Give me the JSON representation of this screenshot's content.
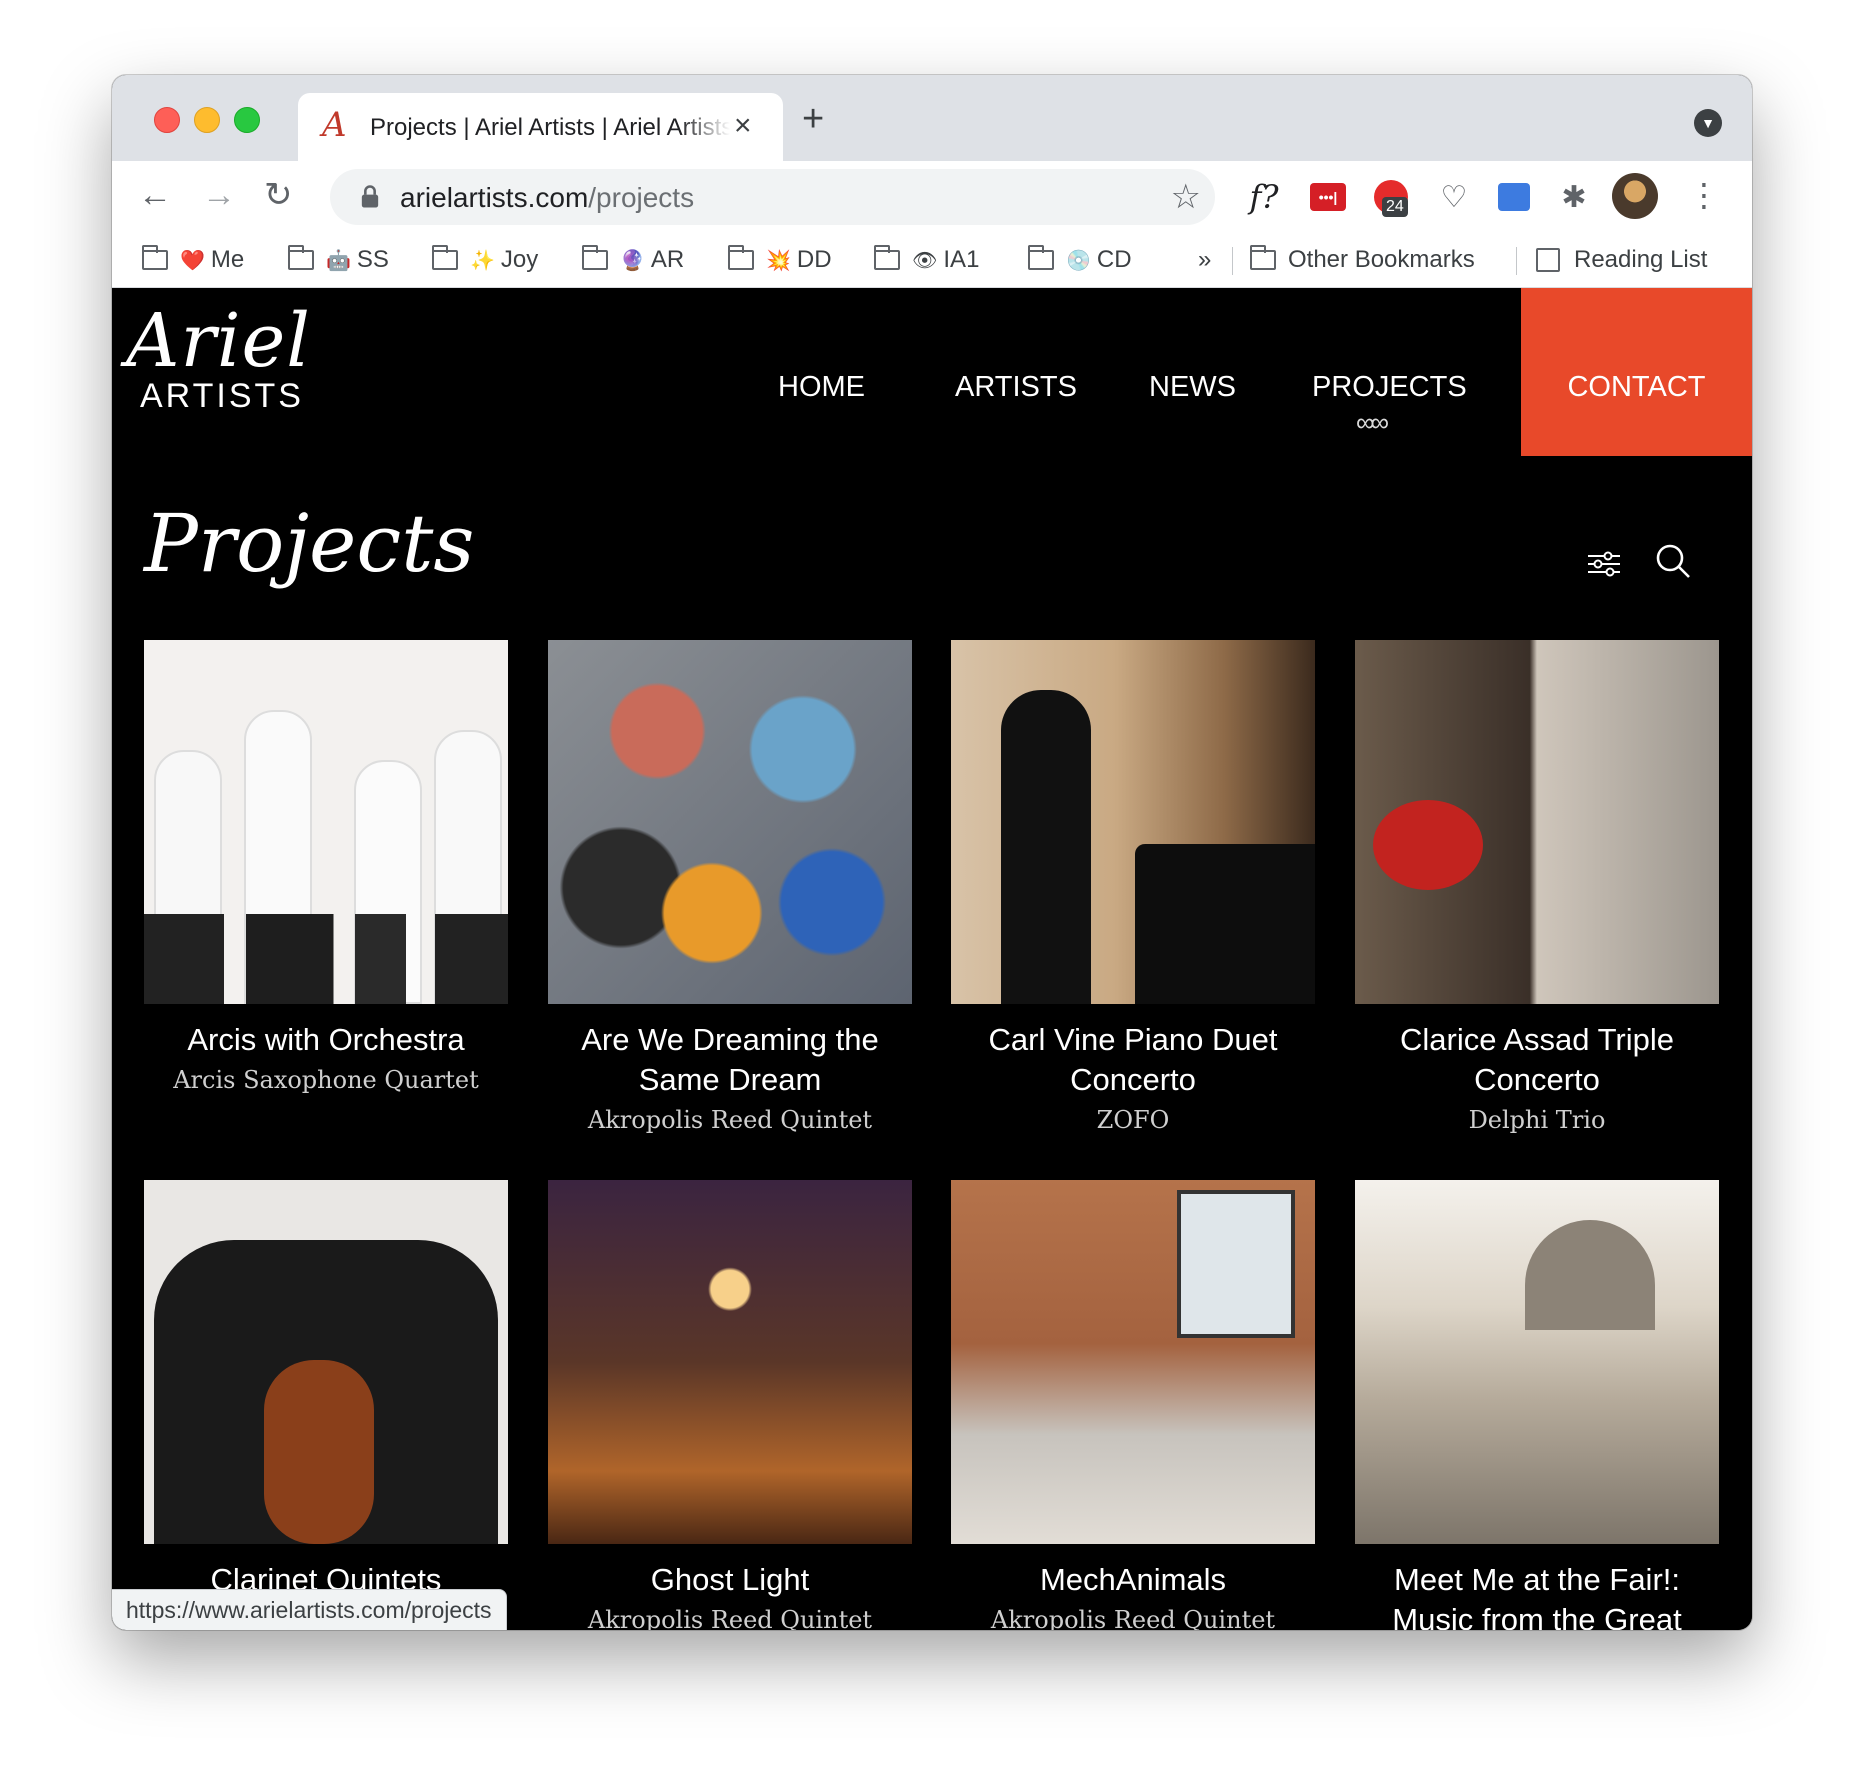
{
  "browser": {
    "tab_title": "Projects | Ariel Artists | Ariel Artists",
    "tab_favicon": "A",
    "url_host": "arielartists.com",
    "url_path": "/projects",
    "status_url": "https://www.arielartists.com/projects",
    "extensions": {
      "fx_label": "f?",
      "adblock_badge": "24"
    },
    "bookmarks": [
      {
        "emoji": "❤️",
        "label": "Me"
      },
      {
        "emoji": "🤖",
        "label": "SS"
      },
      {
        "emoji": "✨",
        "label": "Joy"
      },
      {
        "emoji": "🔮",
        "label": "AR"
      },
      {
        "emoji": "💥",
        "label": "DD"
      },
      {
        "emoji": "👁",
        "label": "IA1"
      },
      {
        "emoji": "💿",
        "label": "CD"
      }
    ],
    "bookmarks_overflow": "»",
    "other_bookmarks": "Other Bookmarks",
    "reading_list": "Reading List"
  },
  "site": {
    "logo_script": "Ariel",
    "logo_sub": "ARTISTS",
    "nav": {
      "home": "HOME",
      "artists": "ARTISTS",
      "news": "NEWS",
      "projects": "PROJECTS",
      "contact": "CONTACT"
    },
    "active_nav": "PROJECTS",
    "accent_color": "#e8492a",
    "page_title": "Projects"
  },
  "projects": [
    {
      "title_lines": [
        "Arcis with Orchestra"
      ],
      "artist": "Arcis Saxophone Quartet"
    },
    {
      "title_lines": [
        "Are We Dreaming the",
        "Same Dream"
      ],
      "artist": "Akropolis Reed Quintet"
    },
    {
      "title_lines": [
        "Carl Vine Piano Duet",
        "Concerto"
      ],
      "artist": "ZOFO"
    },
    {
      "title_lines": [
        "Clarice Assad Triple",
        "Concerto"
      ],
      "artist": "Delphi Trio"
    },
    {
      "title_lines": [
        "Clarinet Quintets"
      ],
      "artist": ""
    },
    {
      "title_lines": [
        "Ghost Light"
      ],
      "artist": "Akropolis Reed Quintet"
    },
    {
      "title_lines": [
        "MechAnimals"
      ],
      "artist": "Akropolis Reed Quintet"
    },
    {
      "title_lines": [
        "Meet Me at the Fair!:",
        "Music from the Great"
      ],
      "artist": ""
    }
  ]
}
